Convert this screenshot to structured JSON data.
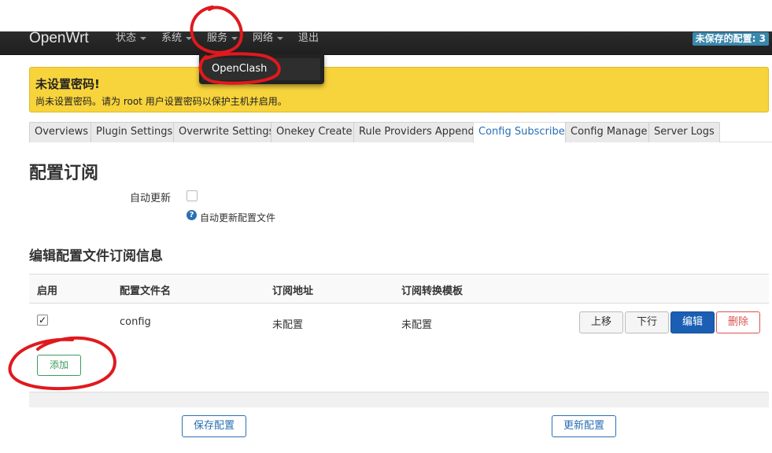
{
  "navbar": {
    "brand": "OpenWrt",
    "menu": [
      {
        "label": "状态",
        "has_caret": true
      },
      {
        "label": "系统",
        "has_caret": true
      },
      {
        "label": "服务",
        "has_caret": true
      },
      {
        "label": "网络",
        "has_caret": true
      },
      {
        "label": "退出",
        "has_caret": false
      }
    ],
    "unsaved_badge": "未保存的配置: 3"
  },
  "dropdown": {
    "items": [
      "OpenClash"
    ]
  },
  "alert": {
    "title": "未设置密码!",
    "text": "尚未设置密码。请为 root 用户设置密码以保护主机并启用。"
  },
  "tabs": [
    {
      "label": "Overviews",
      "active": false
    },
    {
      "label": "Plugin Settings",
      "active": false
    },
    {
      "label": "Overwrite Settings",
      "active": false
    },
    {
      "label": "Onekey Create",
      "active": false
    },
    {
      "label": "Rule Providers Append",
      "active": false
    },
    {
      "label": "Config Subscribe",
      "active": true
    },
    {
      "label": "Config Manage",
      "active": false
    },
    {
      "label": "Server Logs",
      "active": false
    }
  ],
  "page": {
    "title": "配置订阅",
    "auto_update_label": "自动更新",
    "auto_update_checked": false,
    "auto_update_help": "自动更新配置文件",
    "help_icon": "?"
  },
  "subscription_section": {
    "title": "编辑配置文件订阅信息",
    "columns": [
      "启用",
      "配置文件名",
      "订阅地址",
      "订阅转换模板"
    ],
    "rows": [
      {
        "enabled": true,
        "check_glyph": "✓",
        "name": "config",
        "address": "未配置",
        "template": "未配置"
      }
    ],
    "row_buttons": {
      "up": "上移",
      "down": "下行",
      "edit": "编辑",
      "delete": "删除"
    },
    "add_button": "添加"
  },
  "footer": {
    "save_button": "保存配置",
    "update_button": "更新配置"
  },
  "colors": {
    "navbar": "#222222",
    "alert_bg": "#f7d33c",
    "primary": "#1a5fb4",
    "danger": "#d9534f",
    "add": "#3c9a5f",
    "badge": "#3a87ad",
    "annotation": "#e0191e"
  }
}
